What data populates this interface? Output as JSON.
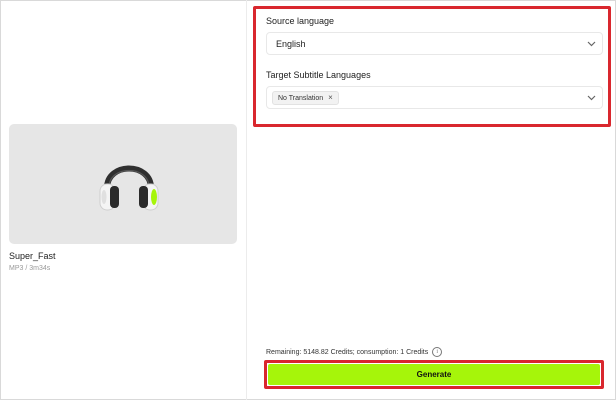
{
  "media": {
    "name": "Super_Fast",
    "meta": "MP3 / 3m34s",
    "icon": "headphone-icon"
  },
  "settings": {
    "source_label": "Source language",
    "source_value": "English",
    "target_label": "Target Subtitle Languages",
    "target_tag": "No Translation",
    "tag_close_symbol": "×"
  },
  "footer": {
    "credits_text": "Remaining: 5148.82 Credits; consumption: 1 Credits",
    "info_symbol": "i",
    "generate_label": "Generate"
  },
  "colors": {
    "accent": "#a6f50a",
    "highlight": "#d9272e"
  }
}
